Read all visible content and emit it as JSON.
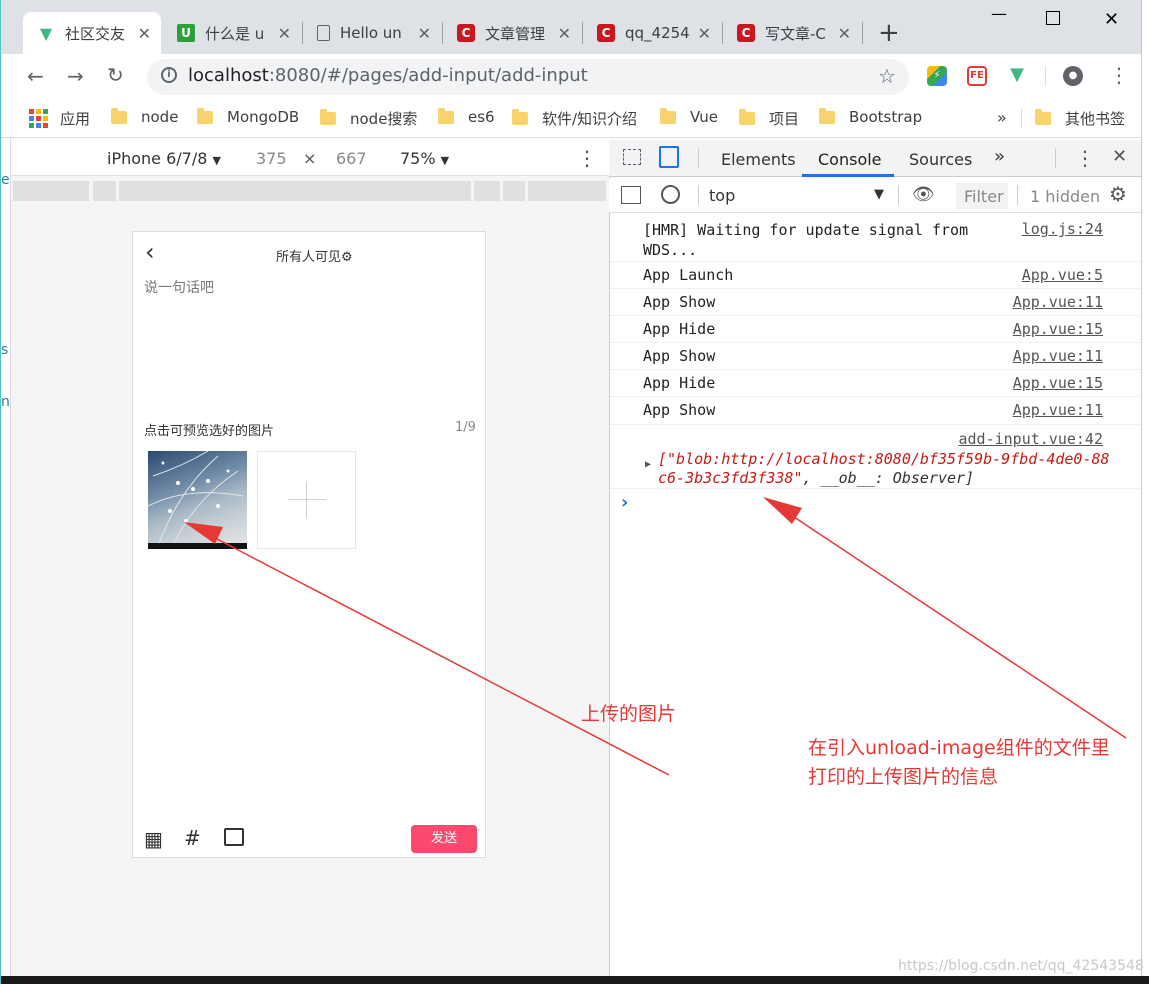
{
  "tabs": [
    {
      "title": "社区交友",
      "favicon_color": "#41b883",
      "favicon_label": "V",
      "active": true
    },
    {
      "title": "什么是 u",
      "favicon_color": "#2e9e3d",
      "favicon_label": "U"
    },
    {
      "title": "Hello un",
      "favicon_color": "#5f6368",
      "favicon_label": ""
    },
    {
      "title": "文章管理",
      "favicon_color": "#c8171e",
      "favicon_label": "C"
    },
    {
      "title": "qq_4254",
      "favicon_color": "#c8171e",
      "favicon_label": "C"
    },
    {
      "title": "写文章-C",
      "favicon_color": "#c8171e",
      "favicon_label": "C"
    }
  ],
  "toolbar": {
    "url_host": "localhost",
    "url_rest": ":8080/#/pages/add-input/add-input"
  },
  "bookmarks": {
    "apps": "应用",
    "items": [
      "node",
      "MongoDB",
      "node搜索",
      "es6",
      "软件/知识介绍",
      "Vue",
      "项目",
      "Bootstrap"
    ],
    "more": "»",
    "other": "其他书签"
  },
  "device_toolbar": {
    "device": "iPhone 6/7/8",
    "width": "375",
    "times": "×",
    "height": "667",
    "zoom": "75%"
  },
  "phone": {
    "back": "‹",
    "visibility": "所有人可见",
    "placeholder": "说一句话吧",
    "preview_label": "点击可预览选好的图片",
    "count": "1/9",
    "send": "发送"
  },
  "devtools": {
    "tabs": [
      "Elements",
      "Console",
      "Sources"
    ],
    "more": "»",
    "context": "top",
    "filter_placeholder": "Filter",
    "hidden": "1 hidden",
    "logs": [
      {
        "msg": "[HMR] Waiting for update signal from\nWDS...",
        "src": "log.js:24"
      },
      {
        "msg": "App Launch",
        "src": "App.vue:5"
      },
      {
        "msg": "App Show",
        "src": "App.vue:11"
      },
      {
        "msg": "App Hide",
        "src": "App.vue:15"
      },
      {
        "msg": "App Show",
        "src": "App.vue:11"
      },
      {
        "msg": "App Hide",
        "src": "App.vue:15"
      },
      {
        "msg": "App Show",
        "src": "App.vue:11"
      }
    ],
    "object_log": {
      "src": "add-input.vue:42",
      "line1": "[\"blob:http://localhost:8080/bf35f59b-9fbd-4de0-88",
      "line2": "c6-3b3c3fd3f338\"",
      "line2_rest": ", __ob__: Observer]"
    },
    "prompt": "›"
  },
  "annotations": {
    "uploaded_image": "上传的图片",
    "print_info_line1": "在引入unload-image组件的文件里",
    "print_info_line2": "打印的上传图片的信息"
  },
  "watermark": "https://blog.csdn.net/qq_42543548",
  "colors": {
    "send_button": "#fc4a6e",
    "annotation": "#e53935",
    "accent": "#1a73e8"
  }
}
